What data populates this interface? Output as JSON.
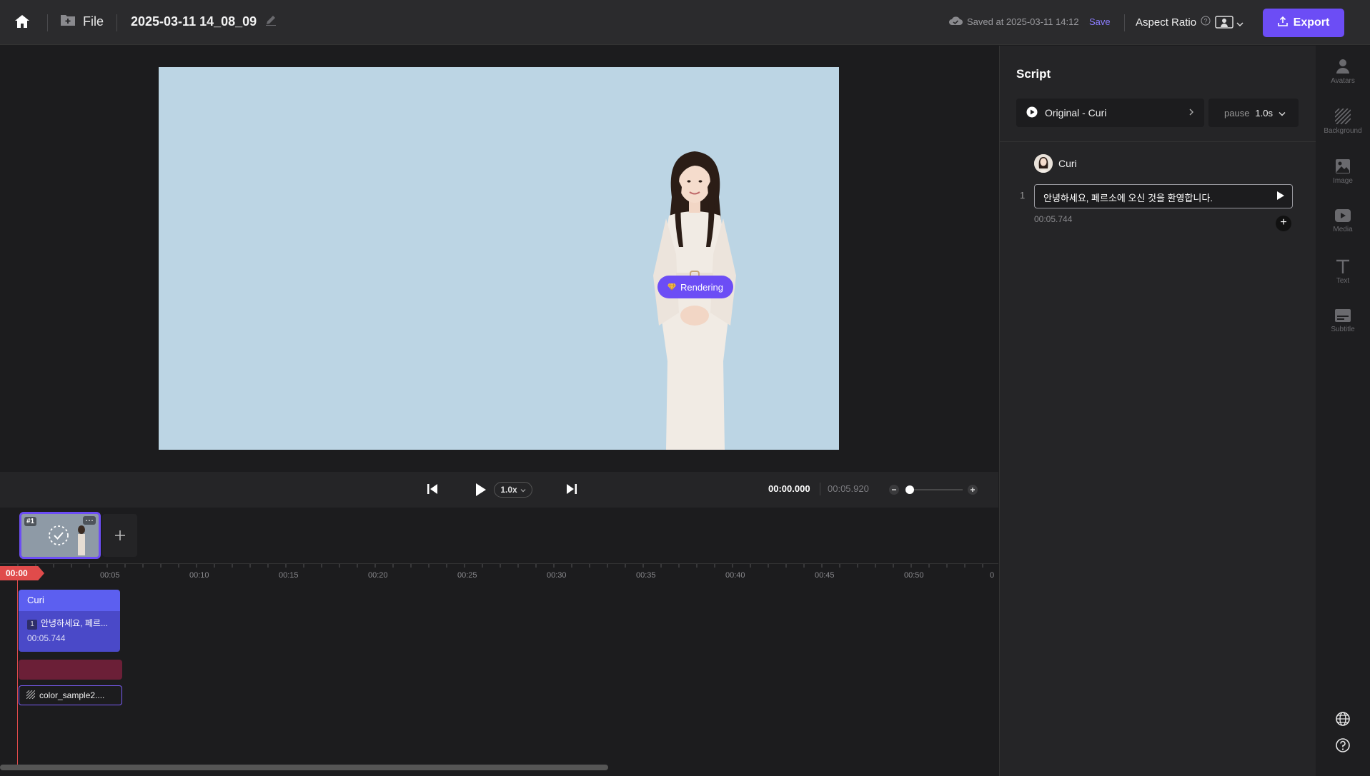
{
  "topbar": {
    "file_label": "File",
    "project_title": "2025-03-11 14_08_09",
    "saved_text": "Saved at 2025-03-11 14:12",
    "save_label": "Save",
    "aspect_label": "Aspect Ratio",
    "export_label": "Export"
  },
  "preview": {
    "background_color": "#bcd5e4",
    "rendering_label": "Rendering"
  },
  "playbar": {
    "speed": "1.0x",
    "current_time": "00:00.000",
    "total_time": "00:05.920"
  },
  "scenes": [
    {
      "number": "#1",
      "more": "⋯"
    }
  ],
  "timeline": {
    "playhead": "00:00",
    "ticks": [
      "00:05",
      "00:10",
      "00:15",
      "00:20",
      "00:25",
      "00:30",
      "00:35",
      "00:40",
      "00:45",
      "00:50",
      "0"
    ],
    "tracks": {
      "avatar_name": "Curi",
      "script_index": "1",
      "script_preview": "안녕하세요, 페르...",
      "script_duration": "00:05.744",
      "background_name": "color_sample2...."
    }
  },
  "script_panel": {
    "title": "Script",
    "voice": "Original - Curi",
    "pause_label": "pause",
    "pause_value": "1.0s",
    "avatar_name": "Curi",
    "lines": [
      {
        "index": "1",
        "text": "안녕하세요, 페르소에 오신 것을 환영합니다.",
        "duration": "00:05.744"
      }
    ]
  },
  "side_rail": {
    "items": [
      {
        "label": "Avatars",
        "icon": "person-icon"
      },
      {
        "label": "Background",
        "icon": "hatch-icon"
      },
      {
        "label": "Image",
        "icon": "image-icon"
      },
      {
        "label": "Media",
        "icon": "play-media-icon"
      },
      {
        "label": "Text",
        "icon": "text-icon"
      },
      {
        "label": "Subtitle",
        "icon": "subtitle-icon"
      }
    ]
  },
  "colors": {
    "accent": "#6c4df5",
    "playhead": "#e04b4b",
    "avatar_track": "#5c5ff0"
  }
}
